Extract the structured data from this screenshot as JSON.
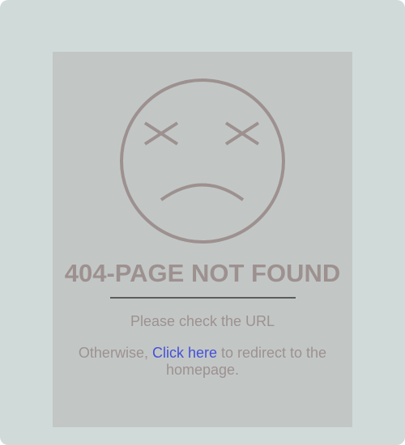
{
  "error": {
    "title": "404-PAGE NOT FOUND",
    "message": "Please check the URL",
    "redirect_prefix": "Otherwise, ",
    "redirect_link": "Click here",
    "redirect_suffix": " to redirect to the homepage."
  },
  "icons": {
    "face": "sad-face-x-eyes-icon"
  },
  "colors": {
    "outer_background": "#d0dad9",
    "panel_background": "#c2c7c6",
    "text": "#9d9190",
    "link": "#4650d6",
    "divider": "#5c5c5c"
  }
}
